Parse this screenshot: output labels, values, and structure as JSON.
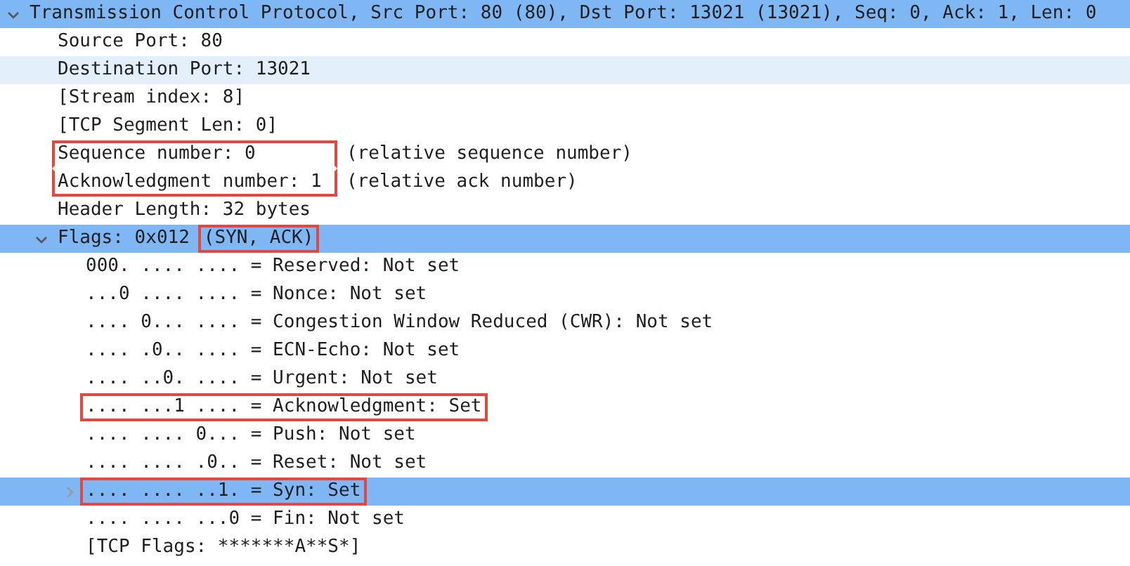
{
  "tree": [
    {
      "label": "Transmission Control Protocol, Src Port: 80 (80), Dst Port: 13021 (13021), Seq: 0, Ack: 1, Len: 0",
      "highlighted": true,
      "hovered": false,
      "boxed": false,
      "expanded": true,
      "children": [
        {
          "label": "Source Port: 80",
          "highlighted": false,
          "hovered": false,
          "boxed": false
        },
        {
          "label": "Destination Port: 13021",
          "highlighted": false,
          "hovered": true,
          "boxed": false
        },
        {
          "label": "[Stream index: 8]",
          "highlighted": false,
          "hovered": false,
          "boxed": false
        },
        {
          "label": "[TCP Segment Len: 0]",
          "highlighted": false,
          "hovered": false,
          "boxed": false
        },
        {
          "label": "Sequence number: 0",
          "note": "(relative sequence number)",
          "note_boxed": false,
          "highlighted": false,
          "hovered": false,
          "boxed": true
        },
        {
          "label": "Acknowledgment number: 1",
          "note": "(relative ack number)",
          "note_boxed": false,
          "highlighted": false,
          "hovered": false,
          "boxed": true
        },
        {
          "label": "Header Length: 32 bytes",
          "highlighted": false,
          "hovered": false,
          "boxed": false
        },
        {
          "label": "Flags: 0x012",
          "note": "(SYN, ACK)",
          "note_boxed": true,
          "highlighted": true,
          "hovered": false,
          "boxed": false,
          "expanded": true,
          "children": [
            {
              "label": "000. .... .... = Reserved: Not set",
              "highlighted": false,
              "hovered": false,
              "boxed": false
            },
            {
              "label": "...0 .... .... = Nonce: Not set",
              "highlighted": false,
              "hovered": false,
              "boxed": false
            },
            {
              "label": ".... 0... .... = Congestion Window Reduced (CWR): Not set",
              "highlighted": false,
              "hovered": false,
              "boxed": false
            },
            {
              "label": ".... .0.. .... = ECN-Echo: Not set",
              "highlighted": false,
              "hovered": false,
              "boxed": false
            },
            {
              "label": ".... ..0. .... = Urgent: Not set",
              "highlighted": false,
              "hovered": false,
              "boxed": false
            },
            {
              "label": ".... ...1 .... = Acknowledgment: Set",
              "highlighted": false,
              "hovered": false,
              "boxed": true
            },
            {
              "label": ".... .... 0... = Push: Not set",
              "highlighted": false,
              "hovered": false,
              "boxed": false
            },
            {
              "label": ".... .... .0.. = Reset: Not set",
              "highlighted": false,
              "hovered": false,
              "boxed": false
            },
            {
              "label": ".... .... ..1. = Syn: Set",
              "highlighted": true,
              "hovered": false,
              "boxed": true,
              "expanded": false
            },
            {
              "label": ".... .... ...0 = Fin: Not set",
              "highlighted": false,
              "hovered": false,
              "boxed": false
            },
            {
              "label": "[TCP Flags: *******A**S*]",
              "highlighted": false,
              "hovered": false,
              "boxed": false
            }
          ]
        }
      ]
    }
  ]
}
